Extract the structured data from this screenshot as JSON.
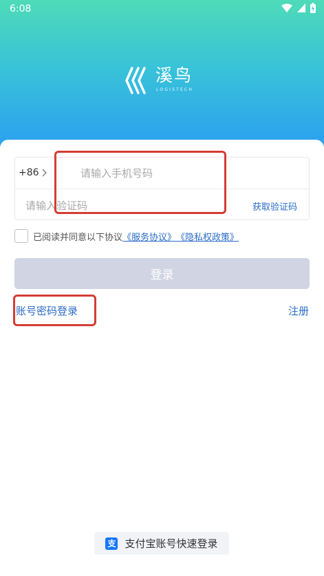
{
  "status_bar": {
    "time": "6:08"
  },
  "brand": {
    "name": "溪鸟",
    "subtitle": "LOGISTECH"
  },
  "phone": {
    "country_code": "+86",
    "placeholder": "请输入手机号码"
  },
  "code": {
    "placeholder": "请输入验证码",
    "get_code_label": "获取验证码"
  },
  "agreement": {
    "prefix": "已阅读并同意以下协议",
    "service": "《服务协议》",
    "privacy": "《隐私权政策》"
  },
  "login_button": "登录",
  "links": {
    "password_login": "账号密码登录",
    "register": "注册"
  },
  "alipay": {
    "icon_glyph": "支",
    "label": "支付宝账号快速登录"
  },
  "colors": {
    "accent": "#2a6cc8",
    "highlight": "#d43c35",
    "button_disabled": "#d1d4e3"
  }
}
